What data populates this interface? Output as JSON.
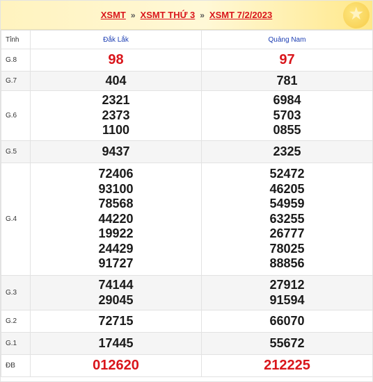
{
  "breadcrumb": {
    "items": [
      "XSMT",
      "XSMT THỨ 3",
      "XSMT 7/2/2023"
    ],
    "separator": "»"
  },
  "table": {
    "header_label": "Tỉnh",
    "provinces": [
      "Đắk Lắk",
      "Quảng Nam"
    ],
    "rows": [
      {
        "label": "G.8",
        "values": [
          [
            "98"
          ],
          [
            "97"
          ]
        ],
        "highlight": true
      },
      {
        "label": "G.7",
        "values": [
          [
            "404"
          ],
          [
            "781"
          ]
        ]
      },
      {
        "label": "G.6",
        "values": [
          [
            "2321",
            "2373",
            "1100"
          ],
          [
            "6984",
            "5703",
            "0855"
          ]
        ]
      },
      {
        "label": "G.5",
        "values": [
          [
            "9437"
          ],
          [
            "2325"
          ]
        ]
      },
      {
        "label": "G.4",
        "values": [
          [
            "72406",
            "93100",
            "78568",
            "44220",
            "19922",
            "24429",
            "91727"
          ],
          [
            "52472",
            "46205",
            "54959",
            "63255",
            "26777",
            "78025",
            "88856"
          ]
        ]
      },
      {
        "label": "G.3",
        "values": [
          [
            "74144",
            "29045"
          ],
          [
            "27912",
            "91594"
          ]
        ]
      },
      {
        "label": "G.2",
        "values": [
          [
            "72715"
          ],
          [
            "66070"
          ]
        ]
      },
      {
        "label": "G.1",
        "values": [
          [
            "17445"
          ],
          [
            "55672"
          ]
        ]
      },
      {
        "label": "ĐB",
        "values": [
          [
            "012620"
          ],
          [
            "212225"
          ]
        ],
        "highlight": true
      }
    ]
  },
  "colors": {
    "accent_red": "#d9151b",
    "province_blue": "#1a3cb2",
    "banner_yellow": "#fff3bf"
  }
}
